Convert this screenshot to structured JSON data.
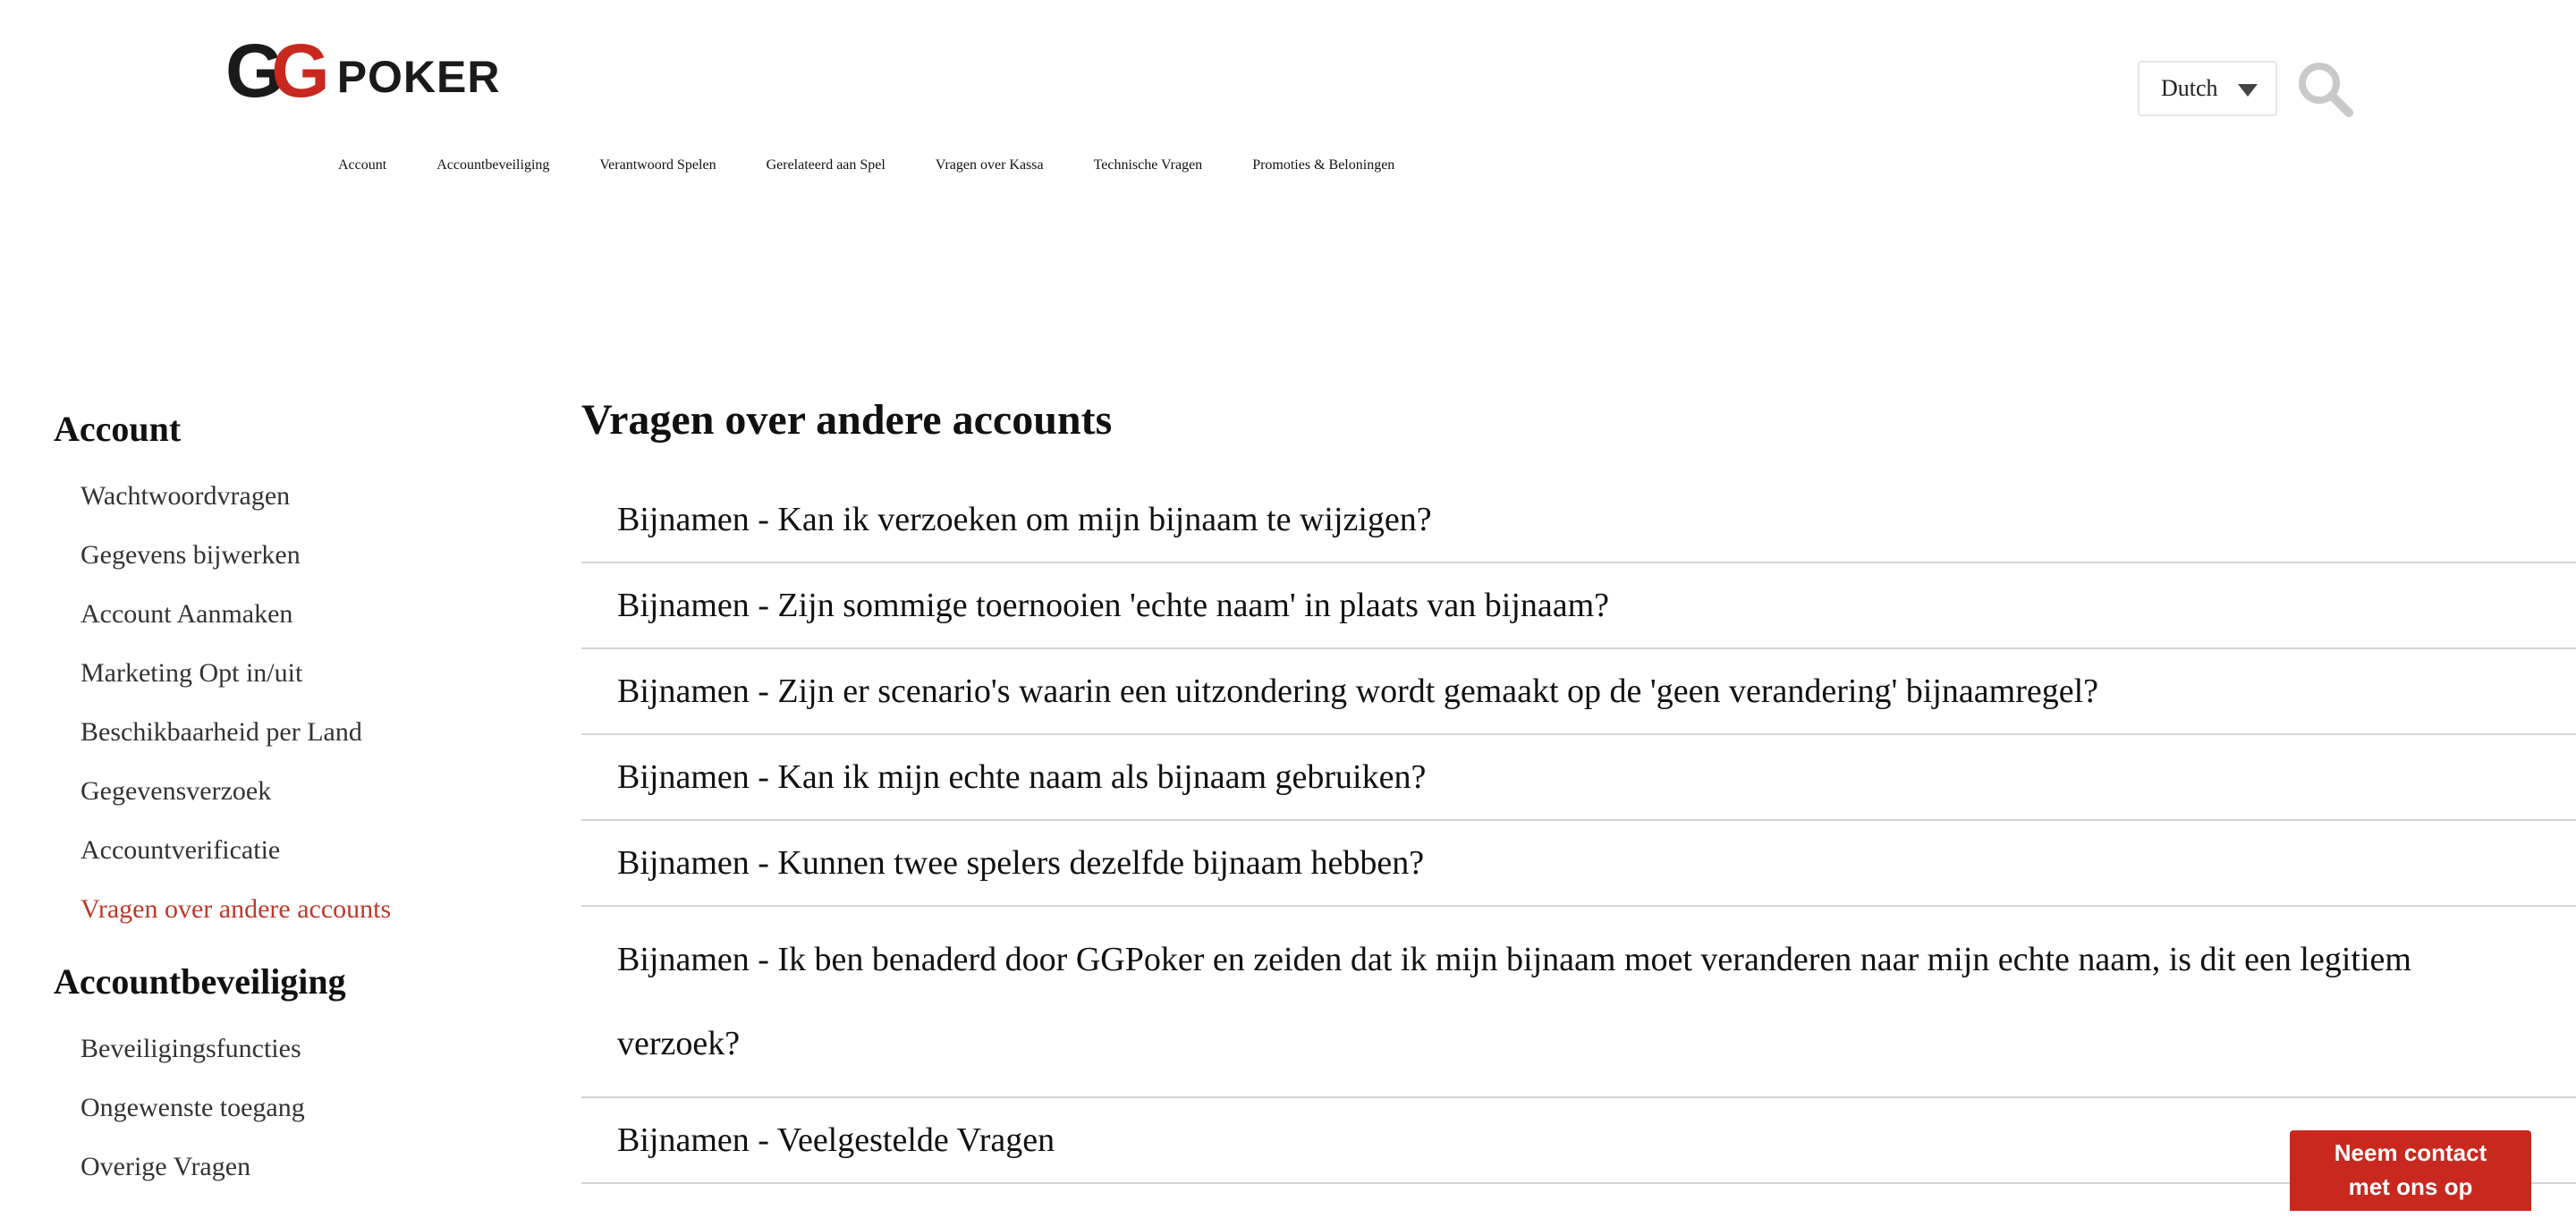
{
  "header": {
    "logo_text": "GGPOKER",
    "language": {
      "selected": "Dutch"
    },
    "search_icon": "search-icon"
  },
  "nav": {
    "items": [
      {
        "label": "Account"
      },
      {
        "label": "Accountbeveiliging"
      },
      {
        "label": "Verantwoord Spelen"
      },
      {
        "label": "Gerelateerd aan Spel"
      },
      {
        "label": "Vragen over Kassa"
      },
      {
        "label": "Technische Vragen"
      },
      {
        "label": "Promoties & Beloningen"
      }
    ]
  },
  "sidebar": {
    "sections": [
      {
        "title": "Account",
        "items": [
          {
            "label": "Wachtwoordvragen"
          },
          {
            "label": "Gegevens bijwerken"
          },
          {
            "label": "Account Aanmaken"
          },
          {
            "label": "Marketing Opt in/uit"
          },
          {
            "label": "Beschikbaarheid per Land"
          },
          {
            "label": "Gegevensverzoek"
          },
          {
            "label": "Accountverificatie"
          },
          {
            "label": "Vragen over andere accounts"
          }
        ]
      },
      {
        "title": "Accountbeveiliging",
        "items": [
          {
            "label": "Beveiligingsfuncties"
          },
          {
            "label": "Ongewenste toegang"
          },
          {
            "label": "Overige Vragen"
          }
        ]
      }
    ]
  },
  "main": {
    "title": "Vragen over andere accounts",
    "faqs": [
      {
        "text": "Bijnamen - Kan ik verzoeken om mijn bijnaam te wijzigen?"
      },
      {
        "text": "Bijnamen - Zijn sommige toernooien 'echte naam' in plaats van bijnaam?"
      },
      {
        "text": "Bijnamen - Zijn er scenario's waarin een uitzondering wordt gemaakt op de 'geen verandering' bijnaamregel?"
      },
      {
        "text": "Bijnamen - Kan ik mijn echte naam als bijnaam gebruiken?"
      },
      {
        "text": "Bijnamen - Kunnen twee spelers dezelfde bijnaam hebben?"
      },
      {
        "text": "Bijnamen - Ik ben benaderd door GGPoker en zeiden dat ik mijn bijnaam moet veranderen naar mijn echte naam, is dit een legitiem verzoek?"
      },
      {
        "text": "Bijnamen - Veelgestelde Vragen"
      }
    ]
  },
  "contact": {
    "label_line1": "Neem contact",
    "label_line2": "met ons op"
  },
  "colors": {
    "accent": "#c8281e",
    "active_link": "#c0392b"
  }
}
